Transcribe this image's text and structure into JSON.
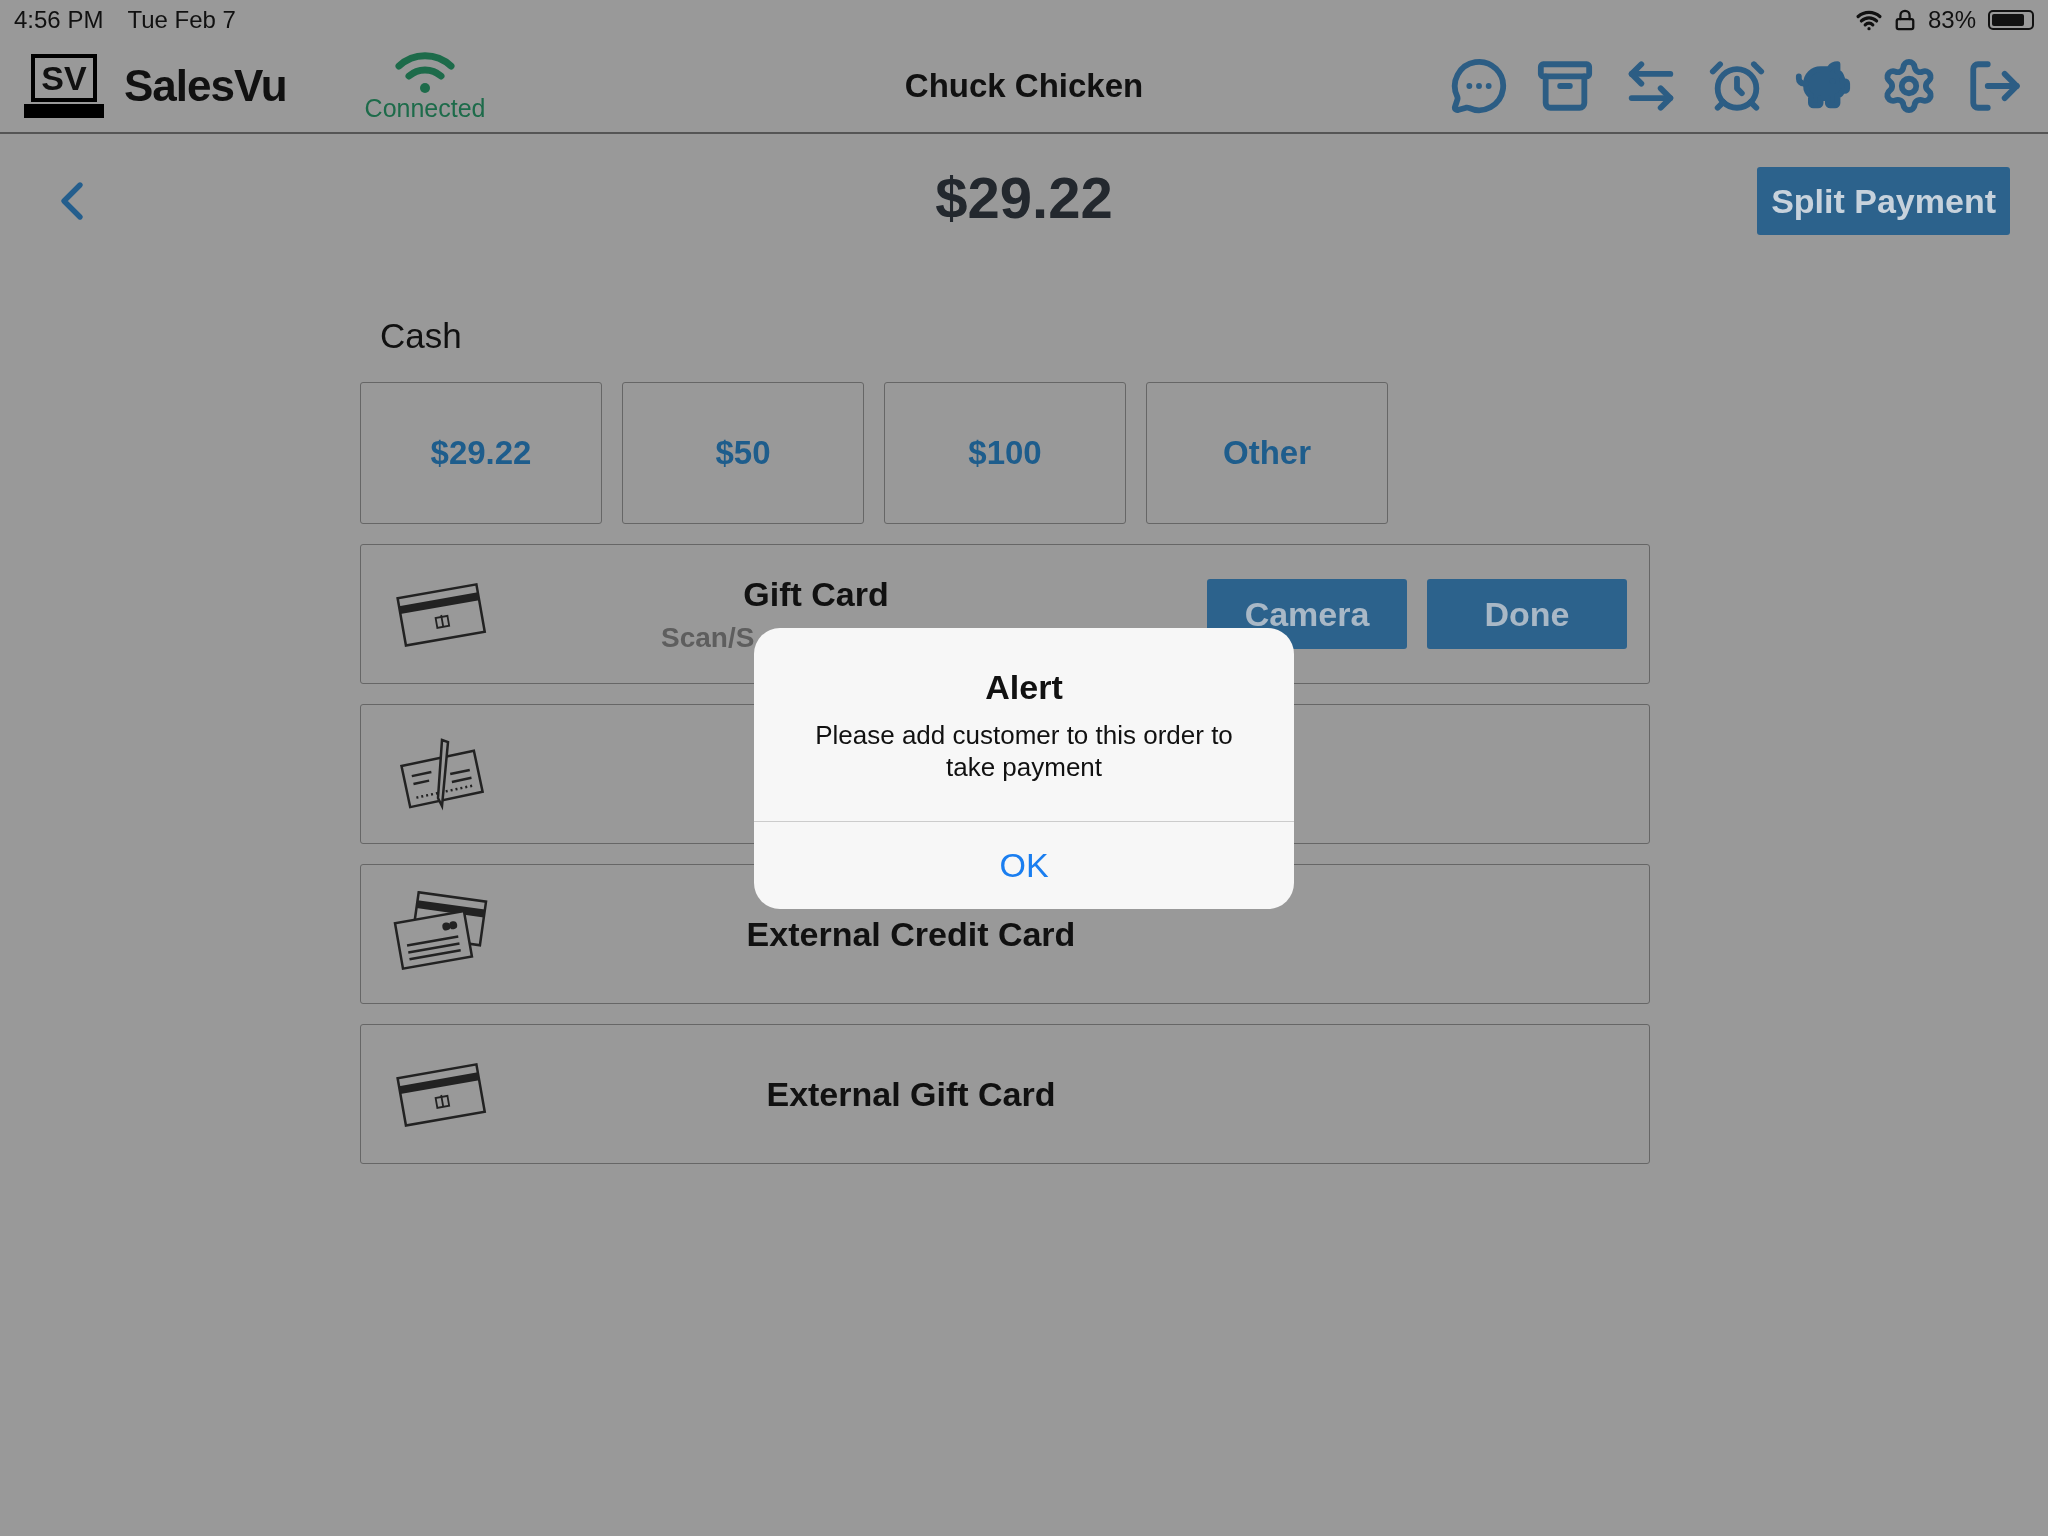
{
  "status_bar": {
    "time": "4:56 PM",
    "date": "Tue Feb 7",
    "battery": "83%"
  },
  "header": {
    "logo_text": "SV",
    "brand": "SalesVu",
    "connection": "Connected",
    "title": "Chuck Chicken"
  },
  "payment": {
    "total": "$29.22",
    "split_button": "Split Payment"
  },
  "cash": {
    "label": "Cash",
    "amounts": [
      "$29.22",
      "$50",
      "$100",
      "Other"
    ]
  },
  "methods": [
    {
      "kind": "gift",
      "label": "Gift Card",
      "subtitle": "Scan/S",
      "buttons": [
        "Camera",
        "Done"
      ]
    },
    {
      "kind": "check"
    },
    {
      "kind": "credit",
      "label": "External Credit Card"
    },
    {
      "kind": "gift",
      "label": "External Gift Card"
    }
  ],
  "alert": {
    "title": "Alert",
    "message": "Please add customer to this order to take payment",
    "button": "OK"
  }
}
